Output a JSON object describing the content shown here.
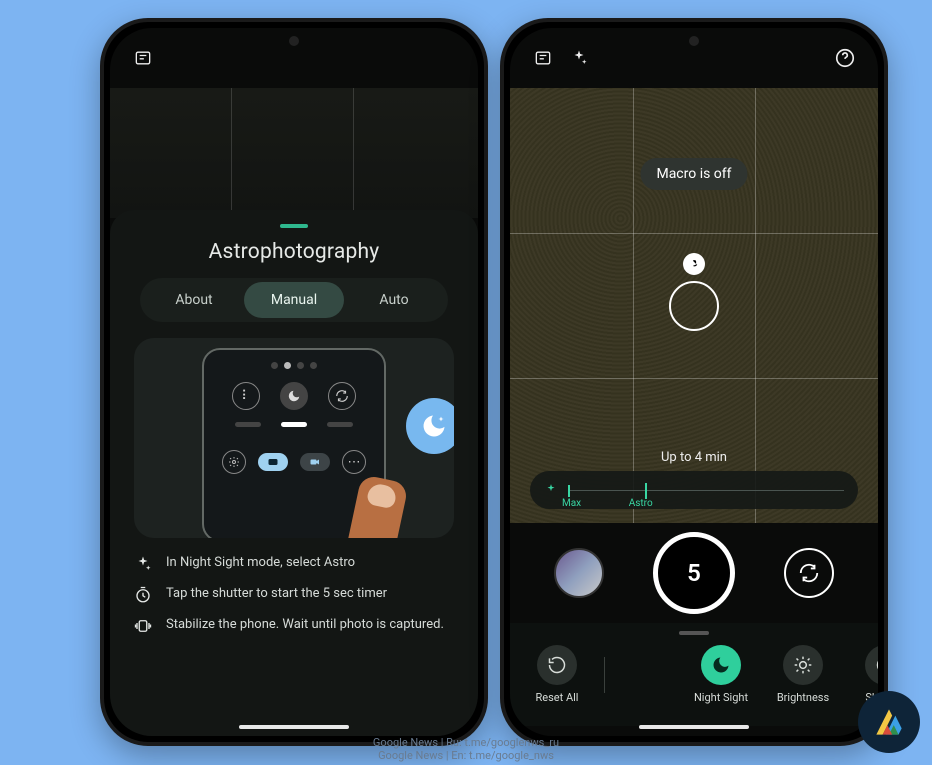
{
  "left": {
    "title": "Astrophotography",
    "tabs": {
      "about": "About",
      "manual": "Manual",
      "auto": "Auto"
    },
    "tips": [
      {
        "icon": "sparkle",
        "text": "In Night Sight mode, select Astro"
      },
      {
        "icon": "timer",
        "text": "Tap the shutter to start the 5 sec timer"
      },
      {
        "icon": "stable",
        "text": "Stabilize the phone. Wait until photo is captured."
      }
    ]
  },
  "right": {
    "toast": "Macro is off",
    "exposure_hint": "Up to 4 min",
    "zoom": {
      "min_label": "Max",
      "max_label": "Astro"
    },
    "shutter_count": "5",
    "modes": [
      {
        "key": "reset",
        "label": "Reset All"
      },
      {
        "key": "night",
        "label": "Night Sight"
      },
      {
        "key": "bright",
        "label": "Brightness"
      },
      {
        "key": "shadow",
        "label": "Shadow"
      }
    ]
  },
  "footer": {
    "line1": "Google News | Ru: t.me/googlenws_ru",
    "line2": "Google News | En: t.me/google_nws"
  }
}
